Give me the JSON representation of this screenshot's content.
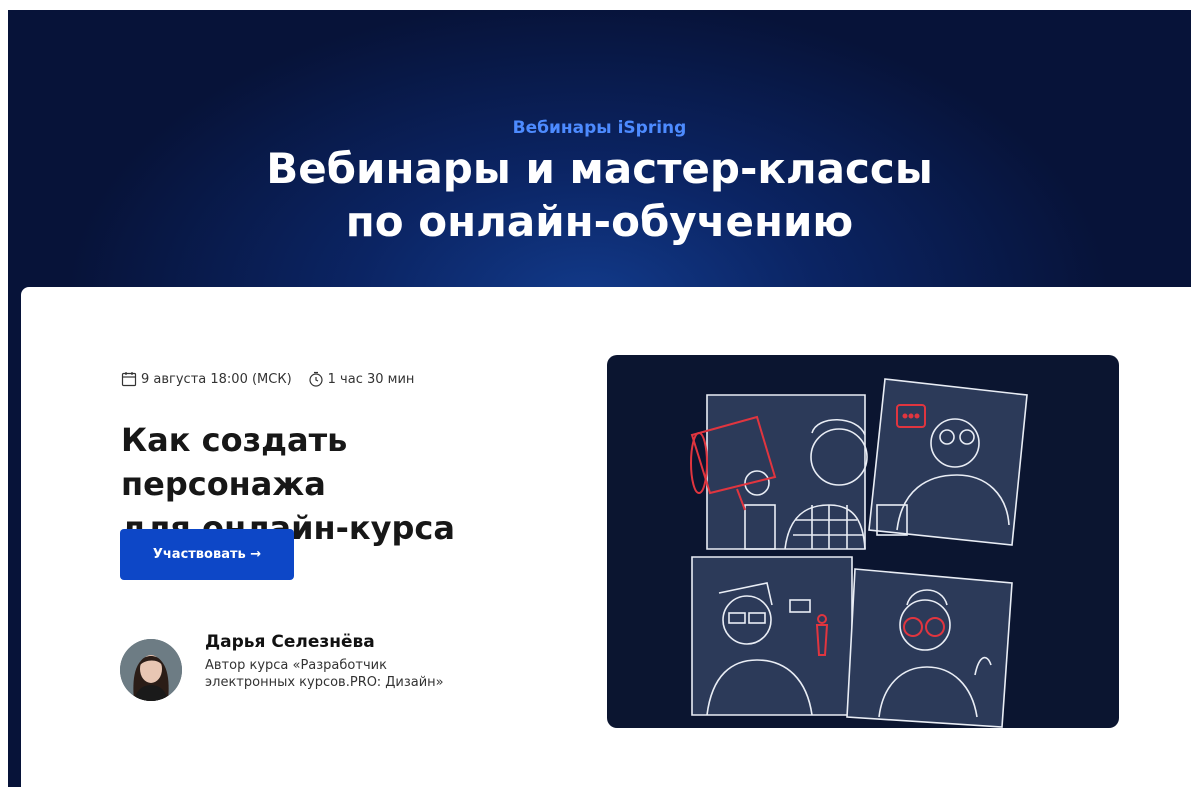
{
  "hero": {
    "eyebrow": "Вебинары iSpring",
    "title_line1": "Вебинары и мастер-классы",
    "title_line2": "по онлайн-обучению"
  },
  "event": {
    "date": "9 августа 18:00 (МСК)",
    "duration": "1 час 30 мин",
    "title_line1": "Как создать персонажа",
    "title_line2": "для онлайн-курса",
    "cta_label": "Участвовать →"
  },
  "speaker": {
    "name": "Дарья Селезнёва",
    "role": "Автор курса «Разработчик электронных курсов.PRO: Дизайн»"
  },
  "icons": {
    "date": "calendar-icon",
    "duration": "timer-icon"
  },
  "colors": {
    "hero_bg": "#0b2463",
    "eyebrow": "#4d8bff",
    "cta_bg": "#0d47c7",
    "illustration_bg": "#0b1530",
    "accent_red": "#e0353f"
  }
}
